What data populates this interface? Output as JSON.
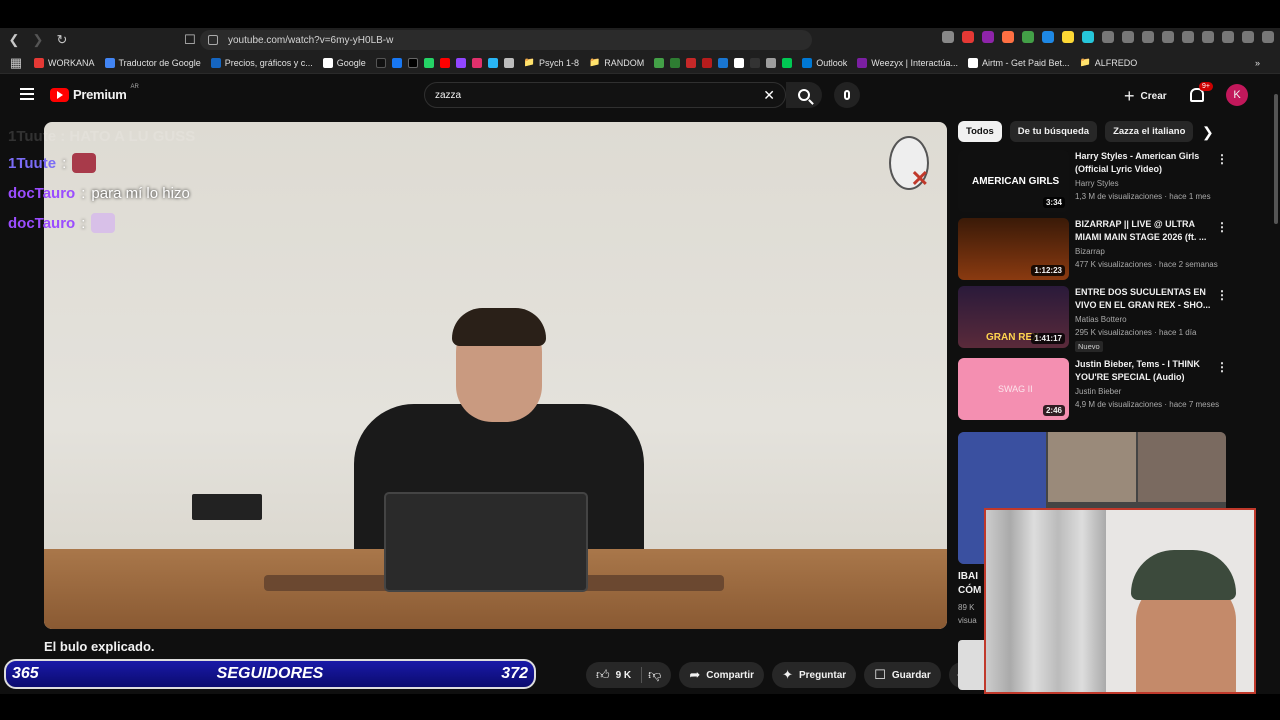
{
  "browser": {
    "url": "youtube.com/watch?v=6my-yH0LB-w",
    "bookmarks": [
      {
        "label": "WORKANA",
        "color": "#e53935"
      },
      {
        "label": "Traductor de Google",
        "color": "#4285f4"
      },
      {
        "label": "Precios, gráficos y c...",
        "color": "#1565c0"
      },
      {
        "label": "Google",
        "color": "#ffffff"
      },
      {
        "label": "Psych 1-8",
        "color": "#9e9e9e"
      },
      {
        "label": "RANDOM",
        "color": "#9e9e9e"
      },
      {
        "label": "Outlook",
        "color": "#0078d4"
      },
      {
        "label": "Weezyx | Interactúa...",
        "color": "#7b1fa2"
      },
      {
        "label": "Airtm - Get Paid Bet...",
        "color": "#ffffff"
      },
      {
        "label": "ALFREDO",
        "color": "#9e9e9e"
      }
    ]
  },
  "youtube": {
    "logo_text": "Premium",
    "country_code": "AR",
    "search_value": "zazza",
    "create_label": "Crear",
    "notif_badge": "9+",
    "avatar_letter": "K"
  },
  "chat": {
    "ghost": "1Tuute : HATO A LU GUSS",
    "lines": [
      {
        "user": "1Tuute",
        "user_color": "#7b6cf6",
        "sep": ":",
        "msg": "",
        "emote_color": "#a83a4a"
      },
      {
        "user": "docTauro",
        "user_color": "#9b4dff",
        "sep": ":",
        "msg": "para mí lo hizo",
        "emote_color": ""
      },
      {
        "user": "docTauro",
        "user_color": "#9b4dff",
        "sep": ":",
        "msg": "",
        "emote_color": "#d8c0e8"
      }
    ]
  },
  "video": {
    "title": "El bulo explicado."
  },
  "actions": {
    "likes": "9 K",
    "share": "Compartir",
    "ask": "Preguntar",
    "save": "Guardar"
  },
  "followers": {
    "current": "365",
    "label": "SEGUIDORES",
    "goal": "372"
  },
  "chips": [
    "Todos",
    "De tu búsqueda",
    "Zazza el italiano"
  ],
  "recommendations": [
    {
      "title": "Harry Styles - American Girls (Official Lyric Video)",
      "channel": "Harry Styles",
      "views": "1,3 M de visualizaciones · hace 1 mes",
      "duration": "3:34",
      "new": "",
      "thumb_color": "#101010",
      "thumb_text": "AMERICAN GIRLS"
    },
    {
      "title": "BIZARRAP || LIVE @ ULTRA MIAMI MAIN STAGE 2026 (ft. ...",
      "channel": "Bizarrap",
      "views": "477 K visualizaciones · hace 2 semanas",
      "duration": "1:12:23",
      "new": "",
      "thumb_color": "#8a3a10",
      "thumb_text": ""
    },
    {
      "title": "ENTRE DOS SUCULENTAS EN VIVO EN EL GRAN REX - SHO...",
      "channel": "Matias Bottero",
      "views": "295 K visualizaciones · hace 1 día",
      "duration": "1:41:17",
      "new": "Nuevo",
      "thumb_color": "#5a2a3a",
      "thumb_text": "GRAN REX"
    },
    {
      "title": "Justin Bieber, Tems - I THINK YOU'RE SPECIAL (Audio)",
      "channel": "Justin Bieber",
      "views": "4,9 M de visualizaciones · hace 7 meses",
      "duration": "2:46",
      "new": "",
      "thumb_color": "#f48fb1",
      "thumb_text": "SWAG II"
    }
  ],
  "mix": {
    "title": "IBAI",
    "title2": "CÓM",
    "meta1": "89 K",
    "meta2": "visua"
  }
}
